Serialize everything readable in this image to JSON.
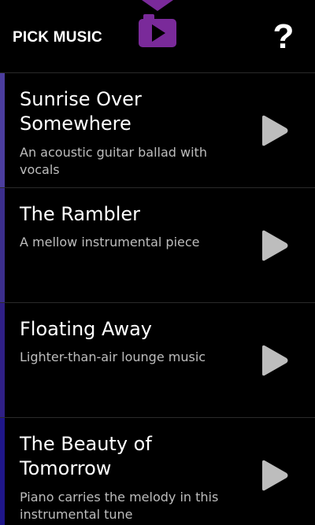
{
  "header": {
    "title": "PICK MUSIC",
    "logo_icon": "camera-play-icon",
    "help_label": "?",
    "accent_color": "#7a2a9a"
  },
  "tracks": [
    {
      "title": "Sunrise Over Somewhere",
      "description": "An acoustic guitar ballad with vocals",
      "accent": "#4b3d9e"
    },
    {
      "title": "The Rambler",
      "description": "A mellow instrumental piece",
      "accent": "#3b2e8c"
    },
    {
      "title": "Floating Away",
      "description": "Lighter-than-air lounge music",
      "accent": "#2f1f86"
    },
    {
      "title": "The Beauty of Tomorrow",
      "description": "Piano carries the melody in this instrumental tune",
      "accent": "#1f168a"
    }
  ]
}
